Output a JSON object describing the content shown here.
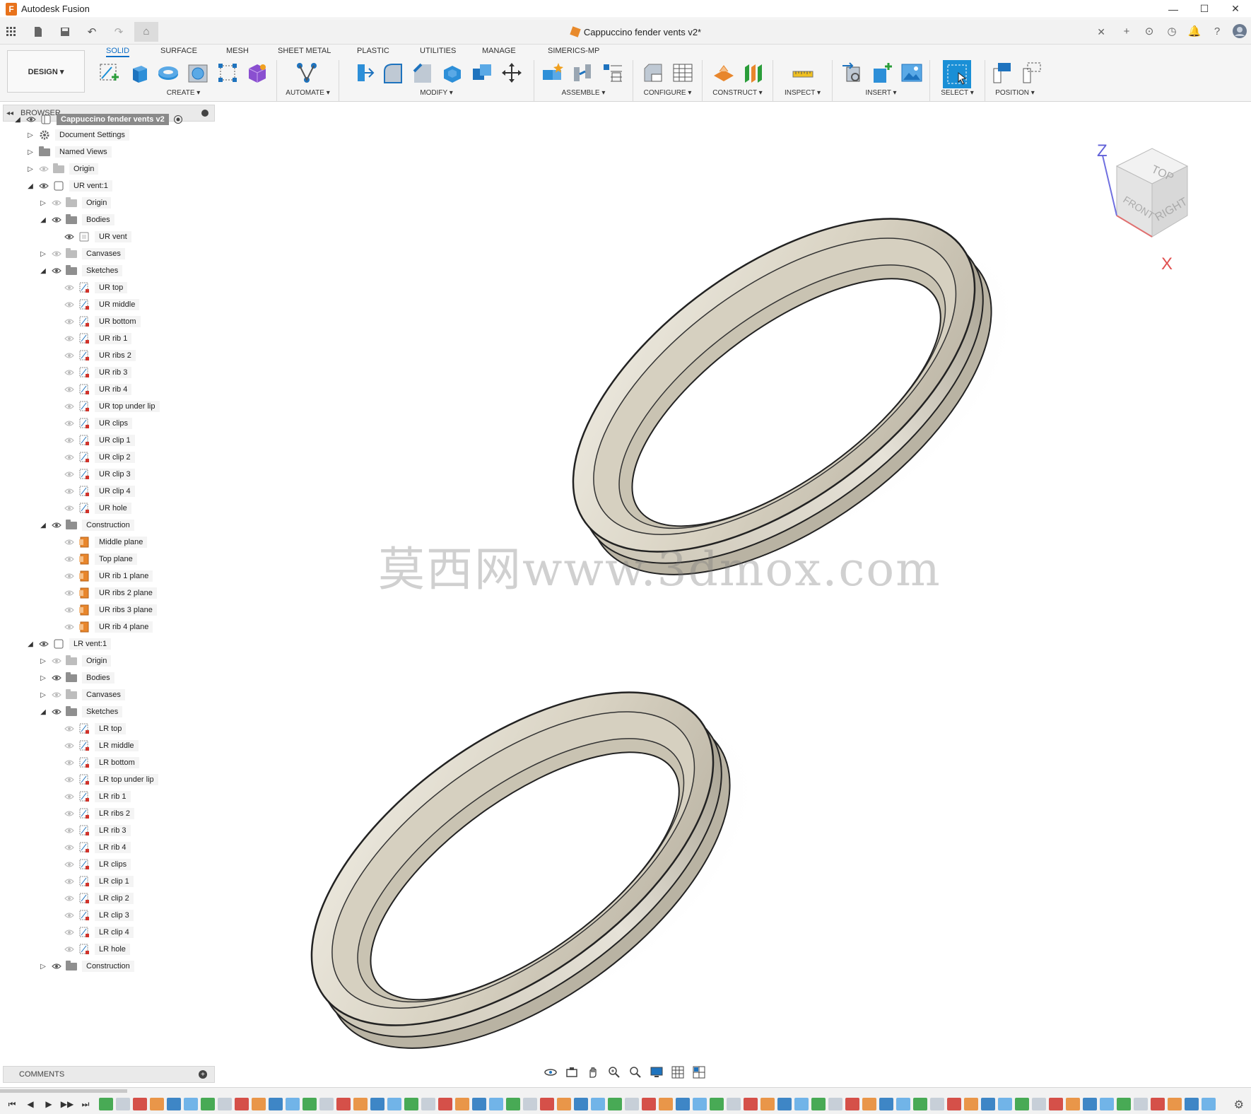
{
  "window": {
    "app_title": "Autodesk Fusion",
    "minimize": "—",
    "maximize": "☐",
    "close": "✕"
  },
  "document": {
    "tab_title": "Cappuccino fender vents v2*",
    "close": "✕"
  },
  "workspace": {
    "mode": "DESIGN ▾",
    "tabs": [
      "SOLID",
      "SURFACE",
      "MESH",
      "SHEET METAL",
      "PLASTIC",
      "UTILITIES",
      "MANAGE",
      "SIMERICS-MP"
    ],
    "active_tab": "SOLID"
  },
  "toolbar_groups": [
    {
      "label": "CREATE ▾"
    },
    {
      "label": "AUTOMATE ▾"
    },
    {
      "label": "MODIFY ▾"
    },
    {
      "label": "ASSEMBLE ▾"
    },
    {
      "label": "CONFIGURE ▾"
    },
    {
      "label": "CONSTRUCT ▾"
    },
    {
      "label": "INSPECT ▾"
    },
    {
      "label": "INSERT ▾"
    },
    {
      "label": "SELECT ▾"
    },
    {
      "label": "POSITION ▾"
    }
  ],
  "browser": {
    "title": "BROWSER",
    "collapse": "◂◂",
    "root": "Cappuccino fender vents v2",
    "rows": [
      {
        "label": "Document Settings"
      },
      {
        "label": "Named Views"
      },
      {
        "label": "Origin"
      },
      {
        "label": "UR vent:1"
      },
      {
        "label": "Origin"
      },
      {
        "label": "Bodies"
      },
      {
        "label": "UR vent"
      },
      {
        "label": "Canvases"
      },
      {
        "label": "Sketches"
      },
      {
        "label": "UR top"
      },
      {
        "label": "UR middle"
      },
      {
        "label": "UR bottom"
      },
      {
        "label": "UR rib 1"
      },
      {
        "label": "UR ribs 2"
      },
      {
        "label": "UR rib 3"
      },
      {
        "label": "UR rib 4"
      },
      {
        "label": "UR top under lip"
      },
      {
        "label": "UR clips"
      },
      {
        "label": "UR clip 1"
      },
      {
        "label": "UR clip 2"
      },
      {
        "label": "UR clip 3"
      },
      {
        "label": "UR clip 4"
      },
      {
        "label": "UR hole"
      },
      {
        "label": "Construction"
      },
      {
        "label": "Middle plane"
      },
      {
        "label": "Top plane"
      },
      {
        "label": "UR rib 1 plane"
      },
      {
        "label": "UR ribs 2 plane"
      },
      {
        "label": "UR ribs 3 plane"
      },
      {
        "label": "UR rib 4 plane"
      },
      {
        "label": "LR vent:1"
      },
      {
        "label": "Origin"
      },
      {
        "label": "Bodies"
      },
      {
        "label": "Canvases"
      },
      {
        "label": "Sketches"
      },
      {
        "label": "LR top"
      },
      {
        "label": "LR middle"
      },
      {
        "label": "LR bottom"
      },
      {
        "label": "LR top under lip"
      },
      {
        "label": "LR rib 1"
      },
      {
        "label": "LR ribs 2"
      },
      {
        "label": "LR rib 3"
      },
      {
        "label": "LR rib 4"
      },
      {
        "label": "LR clips"
      },
      {
        "label": "LR clip 1"
      },
      {
        "label": "LR clip 2"
      },
      {
        "label": "LR clip 3"
      },
      {
        "label": "LR clip 4"
      },
      {
        "label": "LR hole"
      },
      {
        "label": "Construction"
      }
    ]
  },
  "comments": {
    "title": "COMMENTS",
    "add": "+"
  },
  "viewcube": {
    "top": "TOP",
    "front": "FRONT",
    "right": "RIGHT",
    "axis_z": "Z",
    "axis_x": "X"
  },
  "watermark": "莫西网www.3dmox.com",
  "colors": {
    "accent": "#0f6fc6",
    "select_blue": "#1a8fd6",
    "part_color": "#d8d3c5",
    "sketch_red": "#d0342c",
    "construction_orange": "#e8862c"
  },
  "timeline": {
    "controls": [
      "⏮",
      "◀",
      "▶",
      "▶▶",
      "⏭"
    ],
    "settings": "⚙"
  }
}
